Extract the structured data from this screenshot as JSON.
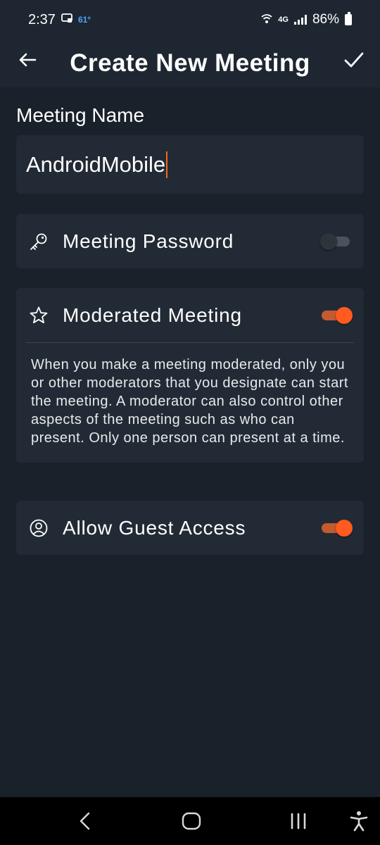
{
  "status_bar": {
    "time": "2:37",
    "temperature": "61°",
    "network": "4G",
    "battery": "86%"
  },
  "header": {
    "title": "Create New Meeting",
    "back_icon": "arrow-left-icon",
    "confirm_icon": "checkmark-icon"
  },
  "form": {
    "meeting_name_label": "Meeting Name",
    "meeting_name_value": "AndroidMobile",
    "password": {
      "label": "Meeting Password",
      "icon": "key-icon",
      "enabled": false
    },
    "moderated": {
      "label": "Moderated Meeting",
      "icon": "star-icon",
      "enabled": true,
      "description": "When you make a meeting moderated, only you or other moderators that you designate can start the meeting. A moderator can also control other aspects of the meeting such as who can present. Only one person can present at a time."
    },
    "guest_access": {
      "label": "Allow Guest Access",
      "icon": "person-circle-icon",
      "enabled": true
    }
  },
  "colors": {
    "background": "#19212b",
    "card": "#222b35",
    "accent": "#ff5a1f"
  }
}
